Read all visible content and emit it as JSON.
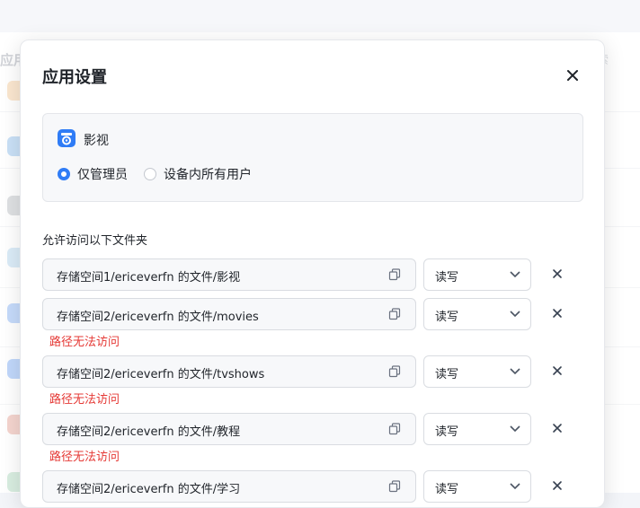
{
  "background": {
    "title": "应用",
    "search_placeholder": "索"
  },
  "dialog": {
    "title": "应用设置",
    "app": {
      "name": "影视",
      "options": [
        "仅管理员",
        "设备内所有用户"
      ],
      "selected": "仅管理员"
    },
    "folders_label": "允许访问以下文件夹",
    "folders": [
      {
        "path": "存储空间1/ericeverfn 的文件/影视",
        "permission": "读写",
        "error": ""
      },
      {
        "path": "存储空间2/ericeverfn 的文件/movies",
        "permission": "读写",
        "error": "路径无法访问"
      },
      {
        "path": "存储空间2/ericeverfn 的文件/tvshows",
        "permission": "读写",
        "error": "路径无法访问"
      },
      {
        "path": "存储空间2/ericeverfn 的文件/教程",
        "permission": "读写",
        "error": "路径无法访问"
      },
      {
        "path": "存储空间2/ericeverfn 的文件/学习",
        "permission": "读写",
        "error": ""
      }
    ]
  },
  "colors": {
    "accent": "#2f7cf6",
    "error": "#e53935"
  }
}
